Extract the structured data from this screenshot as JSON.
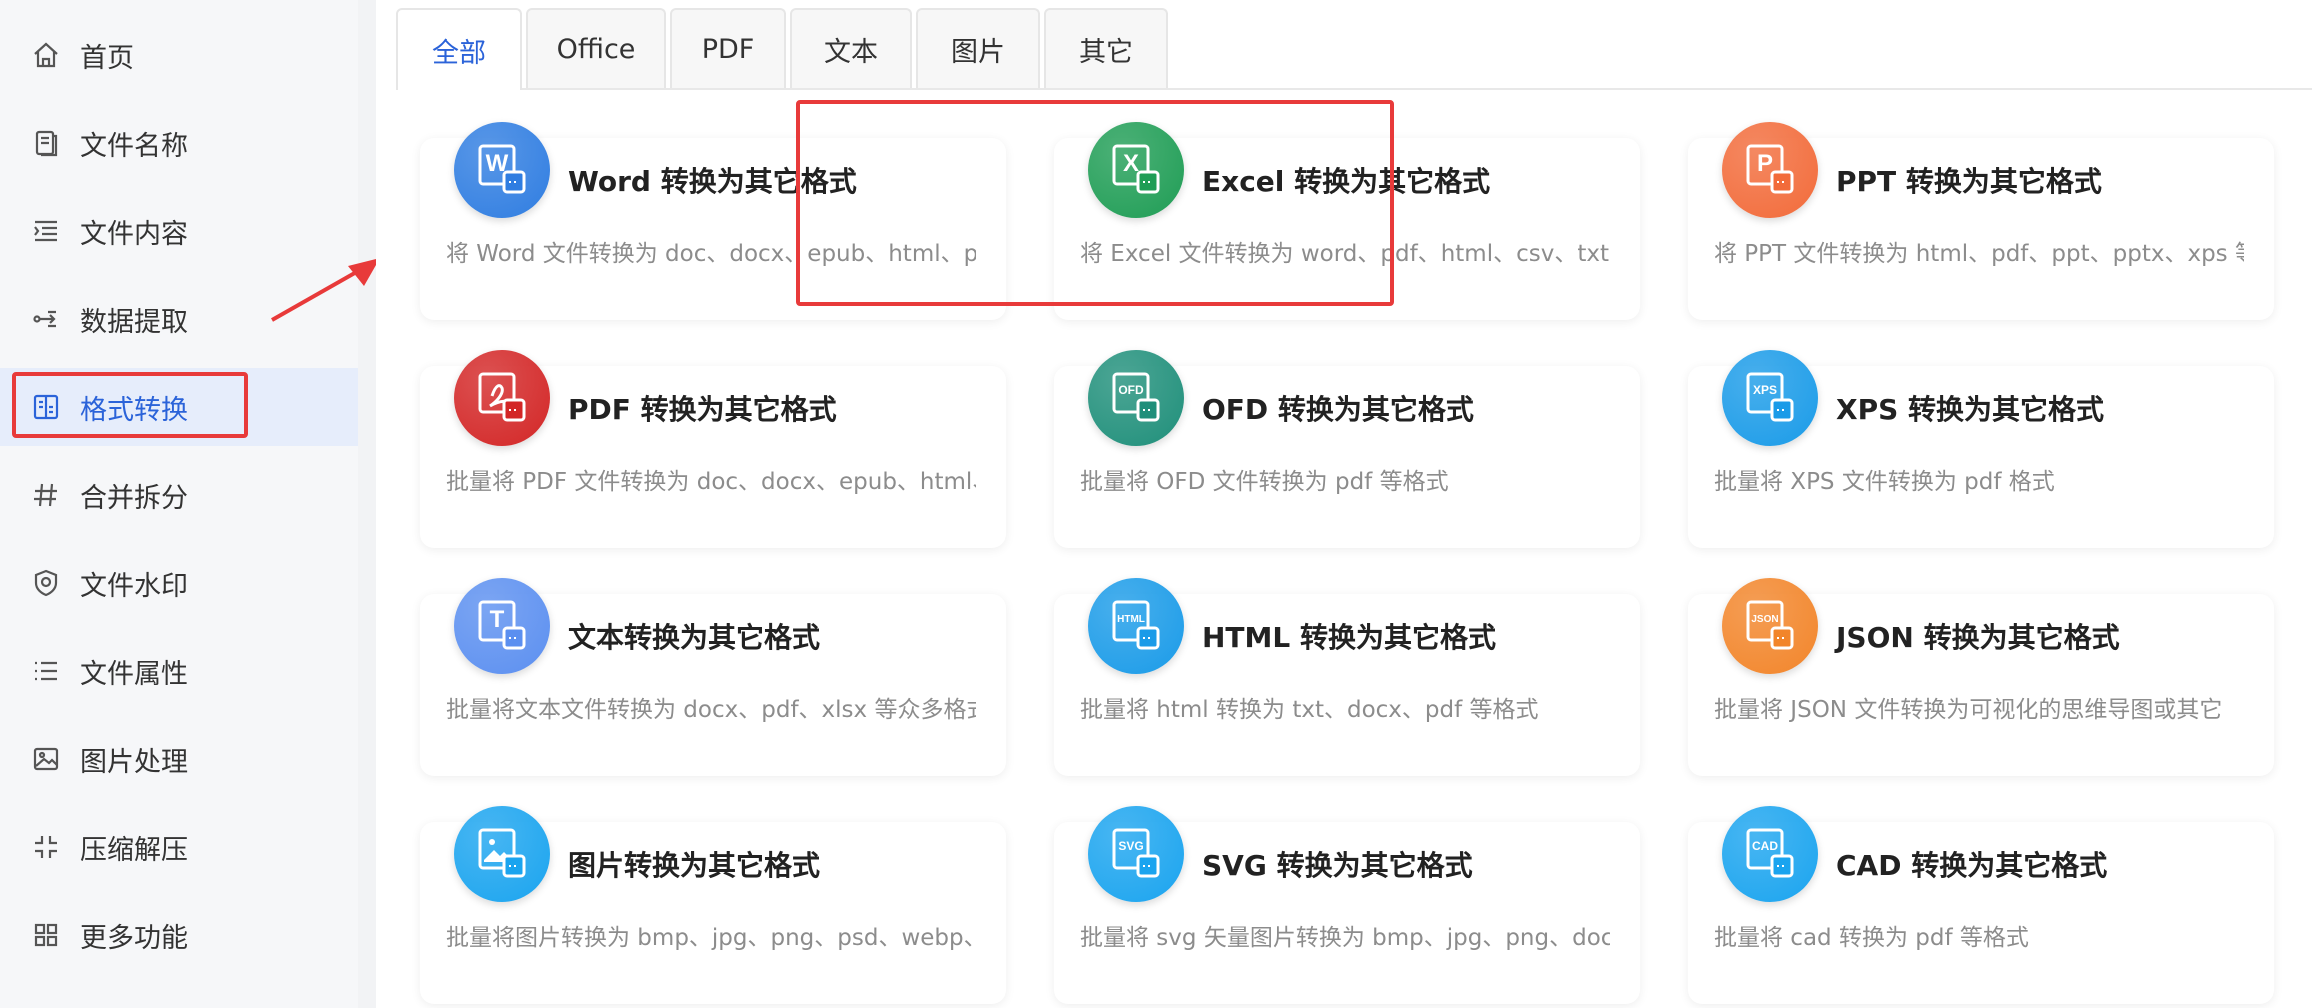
{
  "sidebar": {
    "items": [
      {
        "label": "首页",
        "icon": "home-icon"
      },
      {
        "label": "文件名称",
        "icon": "file-name-icon"
      },
      {
        "label": "文件内容",
        "icon": "file-content-icon"
      },
      {
        "label": "数据提取",
        "icon": "data-extract-icon"
      },
      {
        "label": "格式转换",
        "icon": "format-convert-icon",
        "active": true
      },
      {
        "label": "合并拆分",
        "icon": "merge-split-icon"
      },
      {
        "label": "文件水印",
        "icon": "watermark-icon"
      },
      {
        "label": "文件属性",
        "icon": "file-attributes-icon"
      },
      {
        "label": "图片处理",
        "icon": "image-process-icon"
      },
      {
        "label": "压缩解压",
        "icon": "compress-icon"
      },
      {
        "label": "更多功能",
        "icon": "more-features-icon"
      }
    ]
  },
  "tabs": [
    {
      "label": "全部",
      "active": true
    },
    {
      "label": "Office"
    },
    {
      "label": "PDF"
    },
    {
      "label": "文本"
    },
    {
      "label": "图片"
    },
    {
      "label": "其它"
    }
  ],
  "cards": [
    {
      "title": "Word 转换为其它格式",
      "desc": "将 Word 文件转换为 doc、docx、epub、html、pc",
      "badge_text": "W",
      "color": "#2f7de1",
      "icon": "word-icon"
    },
    {
      "title": "Excel 转换为其它格式",
      "desc": "将 Excel 文件转换为 word、pdf、html、csv、txt、",
      "badge_text": "X",
      "color": "#1f9d55",
      "icon": "excel-icon"
    },
    {
      "title": "PPT 转换为其它格式",
      "desc": "将 PPT 文件转换为 html、pdf、ppt、pptx、xps 等",
      "badge_text": "P",
      "color": "#f26b3a",
      "icon": "ppt-icon"
    },
    {
      "title": "PDF 转换为其它格式",
      "desc": "批量将 PDF 文件转换为 doc、docx、epub、html、",
      "badge_text": "",
      "color": "#d32626",
      "icon": "pdf-icon"
    },
    {
      "title": "OFD 转换为其它格式",
      "desc": "批量将 OFD 文件转换为 pdf 等格式",
      "badge_text": "OFD",
      "color": "#1f8f7a",
      "icon": "ofd-icon"
    },
    {
      "title": "XPS 转换为其它格式",
      "desc": "批量将 XPS 文件转换为 pdf 格式",
      "badge_text": "XPS",
      "color": "#1a9be8",
      "icon": "xps-icon"
    },
    {
      "title": "文本转换为其它格式",
      "desc": "批量将文本文件转换为 docx、pdf、xlsx 等众多格式",
      "badge_text": "T",
      "color": "#5b8ff0",
      "icon": "text-icon"
    },
    {
      "title": "HTML 转换为其它格式",
      "desc": "批量将 html 转换为 txt、docx、pdf 等格式",
      "badge_text": "HTML",
      "color": "#1a9be8",
      "icon": "html-icon"
    },
    {
      "title": "JSON 转换为其它格式",
      "desc": "批量将 JSON 文件转换为可视化的思维导图或其它",
      "badge_text": "JSON",
      "color": "#f2852a",
      "icon": "json-icon"
    },
    {
      "title": "图片转换为其它格式",
      "desc": "批量将图片转换为 bmp、jpg、png、psd、webp、",
      "badge_text": "",
      "color": "#1aa4ef",
      "icon": "image-icon"
    },
    {
      "title": "SVG 转换为其它格式",
      "desc": "批量将 svg 矢量图片转换为 bmp、jpg、png、doc",
      "badge_text": "SVG",
      "color": "#1aa4ef",
      "icon": "svg-icon"
    },
    {
      "title": "CAD 转换为其它格式",
      "desc": "批量将 cad 转换为 pdf 等格式",
      "badge_text": "CAD",
      "color": "#1aa4ef",
      "icon": "cad-icon"
    }
  ],
  "colors": {
    "accent": "#2b63d9",
    "highlight": "#e83a3a"
  }
}
